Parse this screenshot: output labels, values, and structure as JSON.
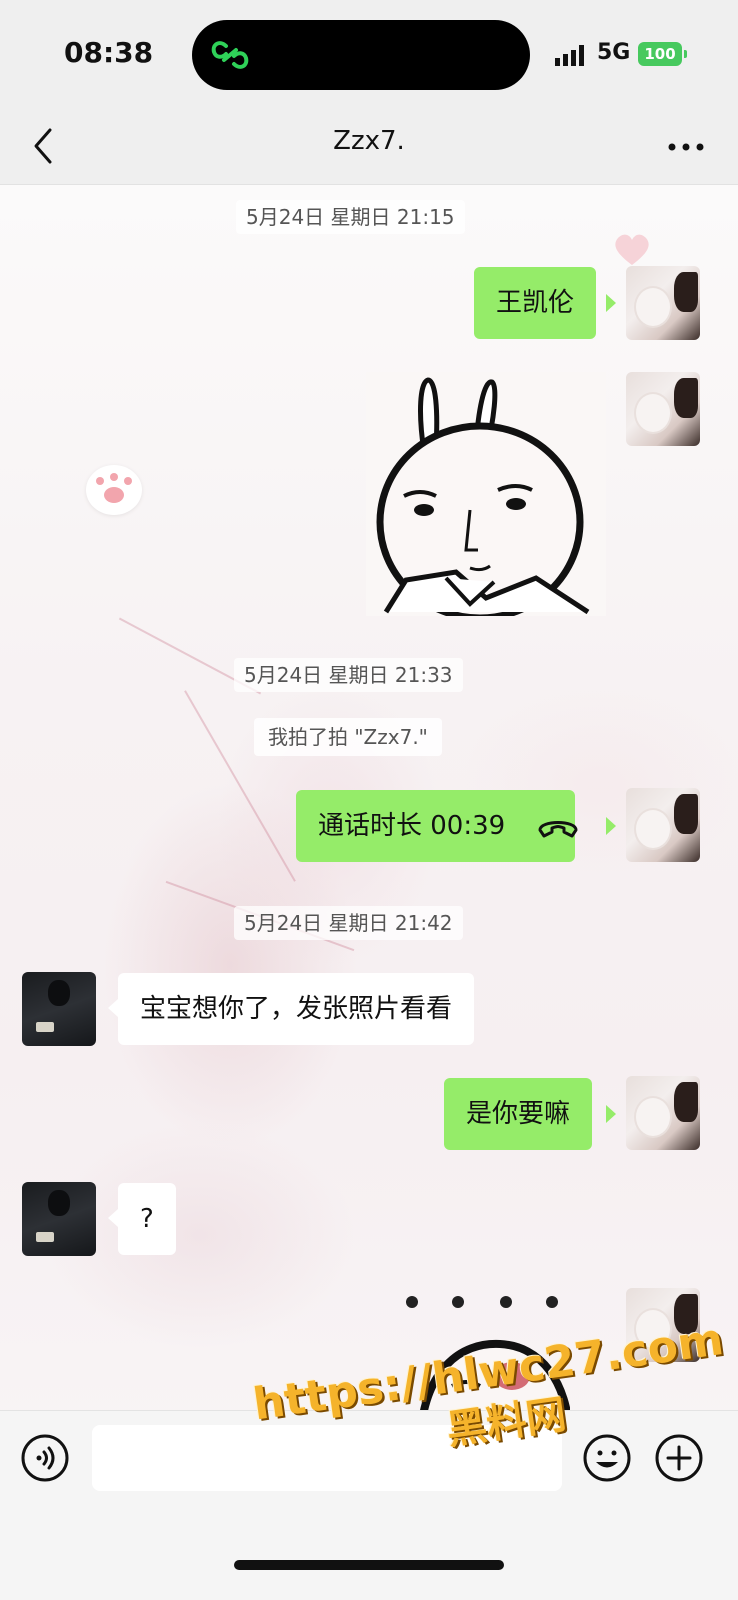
{
  "status_bar": {
    "time": "08:38",
    "network": "5G",
    "battery": "100"
  },
  "nav": {
    "title": "Zzx7."
  },
  "messages": {
    "ts1": "5月24日 星期日 21:15",
    "msg1": "王凯伦",
    "ts2": "5月24日 星期日 21:33",
    "pat": "我拍了拍 \"Zzx7.\"",
    "call": "通话时长 00:39",
    "ts3": "5月24日 星期日 21:42",
    "msg2": "宝宝想你了，发张照片看看",
    "msg3": "是你要嘛",
    "msg4": "?"
  },
  "input": {
    "value": "",
    "placeholder": ""
  },
  "watermark": {
    "url": "https://hlwc27.com",
    "brand": "黑料网"
  },
  "colors": {
    "bubble_me": "#95ec69",
    "bubble_other": "#ffffff",
    "battery": "#47c95e",
    "watermark": "#f5b32b"
  }
}
